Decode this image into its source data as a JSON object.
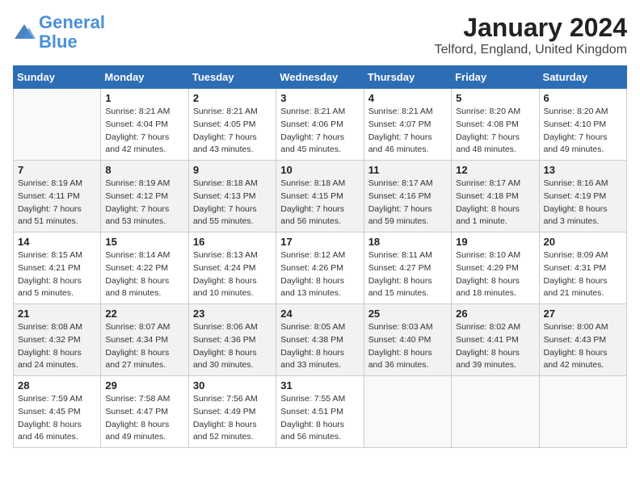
{
  "logo": {
    "line1": "General",
    "line2": "Blue"
  },
  "title": "January 2024",
  "subtitle": "Telford, England, United Kingdom",
  "headers": [
    "Sunday",
    "Monday",
    "Tuesday",
    "Wednesday",
    "Thursday",
    "Friday",
    "Saturday"
  ],
  "weeks": [
    [
      {
        "date": "",
        "sunrise": "",
        "sunset": "",
        "daylight": ""
      },
      {
        "date": "1",
        "sunrise": "Sunrise: 8:21 AM",
        "sunset": "Sunset: 4:04 PM",
        "daylight": "Daylight: 7 hours and 42 minutes."
      },
      {
        "date": "2",
        "sunrise": "Sunrise: 8:21 AM",
        "sunset": "Sunset: 4:05 PM",
        "daylight": "Daylight: 7 hours and 43 minutes."
      },
      {
        "date": "3",
        "sunrise": "Sunrise: 8:21 AM",
        "sunset": "Sunset: 4:06 PM",
        "daylight": "Daylight: 7 hours and 45 minutes."
      },
      {
        "date": "4",
        "sunrise": "Sunrise: 8:21 AM",
        "sunset": "Sunset: 4:07 PM",
        "daylight": "Daylight: 7 hours and 46 minutes."
      },
      {
        "date": "5",
        "sunrise": "Sunrise: 8:20 AM",
        "sunset": "Sunset: 4:08 PM",
        "daylight": "Daylight: 7 hours and 48 minutes."
      },
      {
        "date": "6",
        "sunrise": "Sunrise: 8:20 AM",
        "sunset": "Sunset: 4:10 PM",
        "daylight": "Daylight: 7 hours and 49 minutes."
      }
    ],
    [
      {
        "date": "7",
        "sunrise": "Sunrise: 8:19 AM",
        "sunset": "Sunset: 4:11 PM",
        "daylight": "Daylight: 7 hours and 51 minutes."
      },
      {
        "date": "8",
        "sunrise": "Sunrise: 8:19 AM",
        "sunset": "Sunset: 4:12 PM",
        "daylight": "Daylight: 7 hours and 53 minutes."
      },
      {
        "date": "9",
        "sunrise": "Sunrise: 8:18 AM",
        "sunset": "Sunset: 4:13 PM",
        "daylight": "Daylight: 7 hours and 55 minutes."
      },
      {
        "date": "10",
        "sunrise": "Sunrise: 8:18 AM",
        "sunset": "Sunset: 4:15 PM",
        "daylight": "Daylight: 7 hours and 56 minutes."
      },
      {
        "date": "11",
        "sunrise": "Sunrise: 8:17 AM",
        "sunset": "Sunset: 4:16 PM",
        "daylight": "Daylight: 7 hours and 59 minutes."
      },
      {
        "date": "12",
        "sunrise": "Sunrise: 8:17 AM",
        "sunset": "Sunset: 4:18 PM",
        "daylight": "Daylight: 8 hours and 1 minute."
      },
      {
        "date": "13",
        "sunrise": "Sunrise: 8:16 AM",
        "sunset": "Sunset: 4:19 PM",
        "daylight": "Daylight: 8 hours and 3 minutes."
      }
    ],
    [
      {
        "date": "14",
        "sunrise": "Sunrise: 8:15 AM",
        "sunset": "Sunset: 4:21 PM",
        "daylight": "Daylight: 8 hours and 5 minutes."
      },
      {
        "date": "15",
        "sunrise": "Sunrise: 8:14 AM",
        "sunset": "Sunset: 4:22 PM",
        "daylight": "Daylight: 8 hours and 8 minutes."
      },
      {
        "date": "16",
        "sunrise": "Sunrise: 8:13 AM",
        "sunset": "Sunset: 4:24 PM",
        "daylight": "Daylight: 8 hours and 10 minutes."
      },
      {
        "date": "17",
        "sunrise": "Sunrise: 8:12 AM",
        "sunset": "Sunset: 4:26 PM",
        "daylight": "Daylight: 8 hours and 13 minutes."
      },
      {
        "date": "18",
        "sunrise": "Sunrise: 8:11 AM",
        "sunset": "Sunset: 4:27 PM",
        "daylight": "Daylight: 8 hours and 15 minutes."
      },
      {
        "date": "19",
        "sunrise": "Sunrise: 8:10 AM",
        "sunset": "Sunset: 4:29 PM",
        "daylight": "Daylight: 8 hours and 18 minutes."
      },
      {
        "date": "20",
        "sunrise": "Sunrise: 8:09 AM",
        "sunset": "Sunset: 4:31 PM",
        "daylight": "Daylight: 8 hours and 21 minutes."
      }
    ],
    [
      {
        "date": "21",
        "sunrise": "Sunrise: 8:08 AM",
        "sunset": "Sunset: 4:32 PM",
        "daylight": "Daylight: 8 hours and 24 minutes."
      },
      {
        "date": "22",
        "sunrise": "Sunrise: 8:07 AM",
        "sunset": "Sunset: 4:34 PM",
        "daylight": "Daylight: 8 hours and 27 minutes."
      },
      {
        "date": "23",
        "sunrise": "Sunrise: 8:06 AM",
        "sunset": "Sunset: 4:36 PM",
        "daylight": "Daylight: 8 hours and 30 minutes."
      },
      {
        "date": "24",
        "sunrise": "Sunrise: 8:05 AM",
        "sunset": "Sunset: 4:38 PM",
        "daylight": "Daylight: 8 hours and 33 minutes."
      },
      {
        "date": "25",
        "sunrise": "Sunrise: 8:03 AM",
        "sunset": "Sunset: 4:40 PM",
        "daylight": "Daylight: 8 hours and 36 minutes."
      },
      {
        "date": "26",
        "sunrise": "Sunrise: 8:02 AM",
        "sunset": "Sunset: 4:41 PM",
        "daylight": "Daylight: 8 hours and 39 minutes."
      },
      {
        "date": "27",
        "sunrise": "Sunrise: 8:00 AM",
        "sunset": "Sunset: 4:43 PM",
        "daylight": "Daylight: 8 hours and 42 minutes."
      }
    ],
    [
      {
        "date": "28",
        "sunrise": "Sunrise: 7:59 AM",
        "sunset": "Sunset: 4:45 PM",
        "daylight": "Daylight: 8 hours and 46 minutes."
      },
      {
        "date": "29",
        "sunrise": "Sunrise: 7:58 AM",
        "sunset": "Sunset: 4:47 PM",
        "daylight": "Daylight: 8 hours and 49 minutes."
      },
      {
        "date": "30",
        "sunrise": "Sunrise: 7:56 AM",
        "sunset": "Sunset: 4:49 PM",
        "daylight": "Daylight: 8 hours and 52 minutes."
      },
      {
        "date": "31",
        "sunrise": "Sunrise: 7:55 AM",
        "sunset": "Sunset: 4:51 PM",
        "daylight": "Daylight: 8 hours and 56 minutes."
      },
      {
        "date": "",
        "sunrise": "",
        "sunset": "",
        "daylight": ""
      },
      {
        "date": "",
        "sunrise": "",
        "sunset": "",
        "daylight": ""
      },
      {
        "date": "",
        "sunrise": "",
        "sunset": "",
        "daylight": ""
      }
    ]
  ]
}
